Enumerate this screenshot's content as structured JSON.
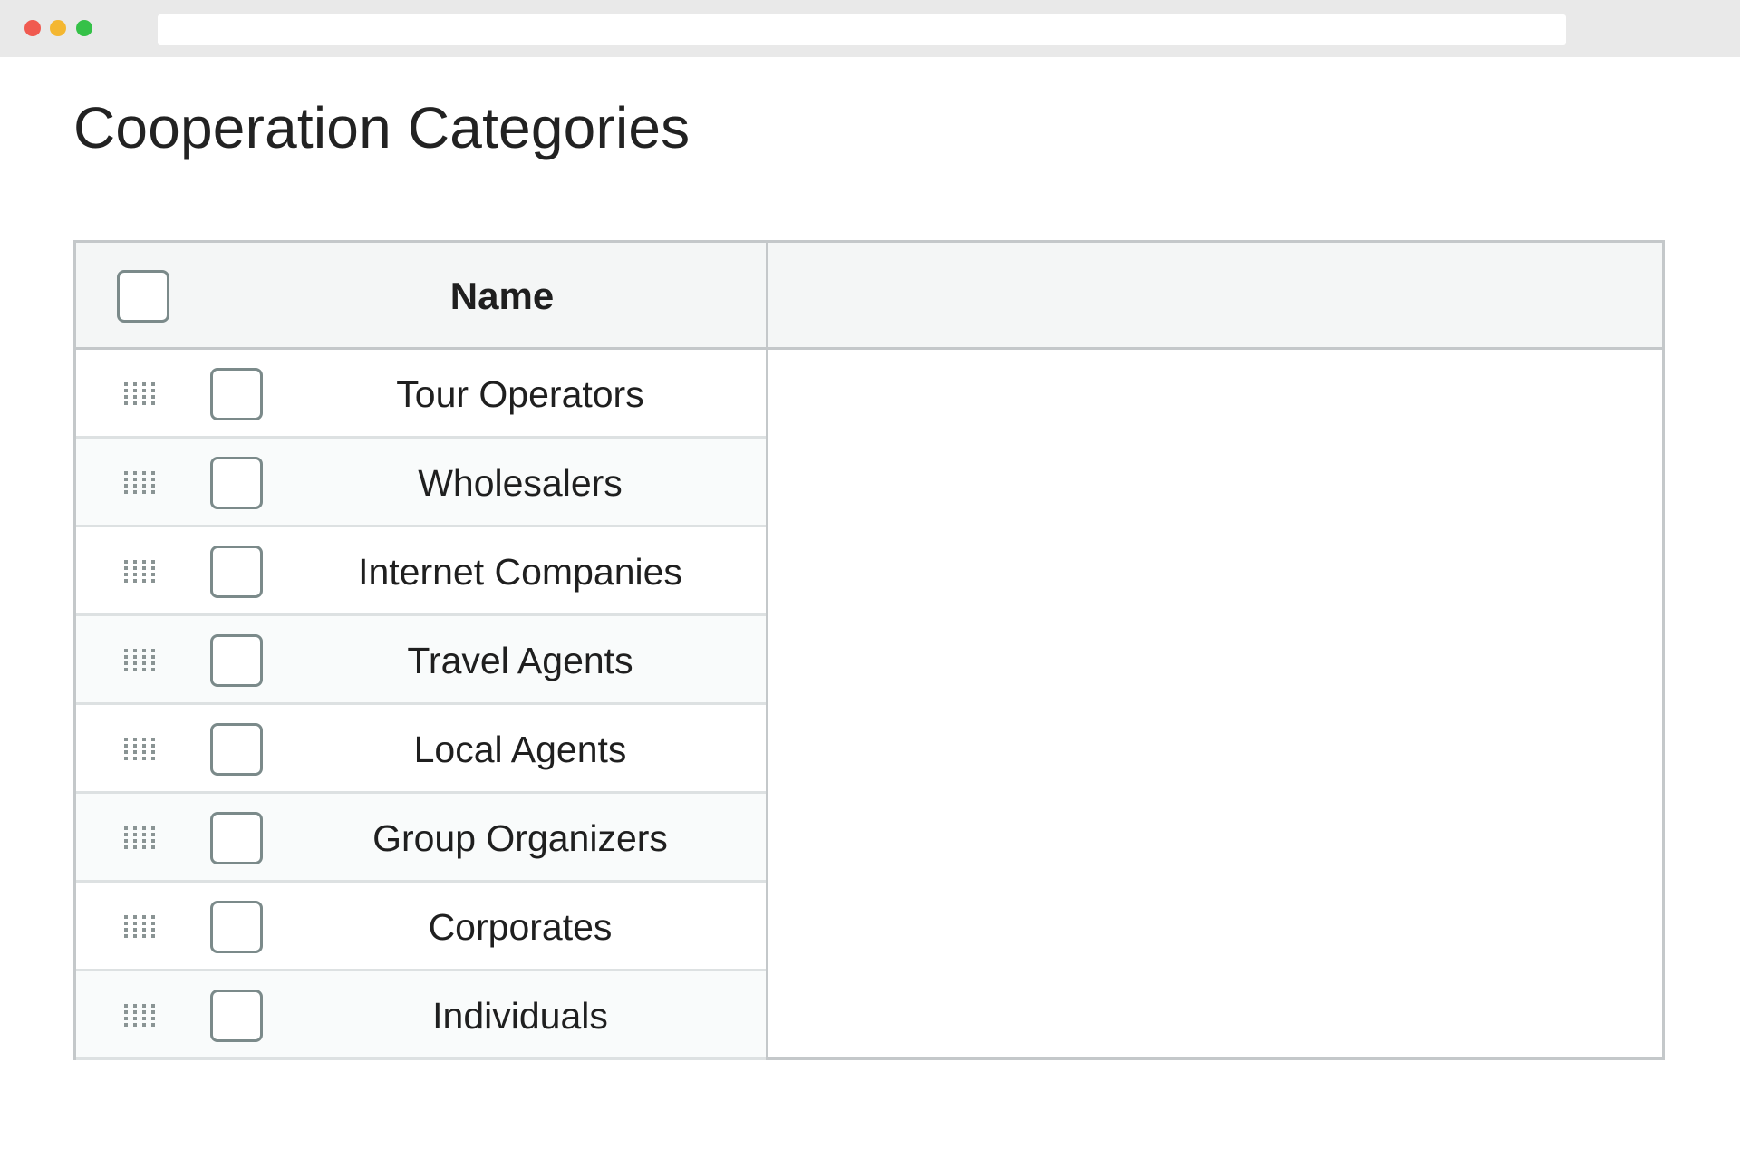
{
  "page": {
    "title": "Cooperation Categories"
  },
  "table": {
    "header": {
      "name_label": "Name"
    },
    "rows": [
      {
        "label": "Tour Operators"
      },
      {
        "label": "Wholesalers"
      },
      {
        "label": "Internet Companies"
      },
      {
        "label": "Travel Agents"
      },
      {
        "label": "Local Agents"
      },
      {
        "label": "Group Organizers"
      },
      {
        "label": "Corporates"
      },
      {
        "label": "Individuals"
      }
    ]
  },
  "icons": {
    "drag": "drag-handle-icon"
  },
  "colors": {
    "border": "#c4c8ca",
    "header_bg": "#f4f6f6",
    "checkbox_border": "#7b8a8a"
  }
}
